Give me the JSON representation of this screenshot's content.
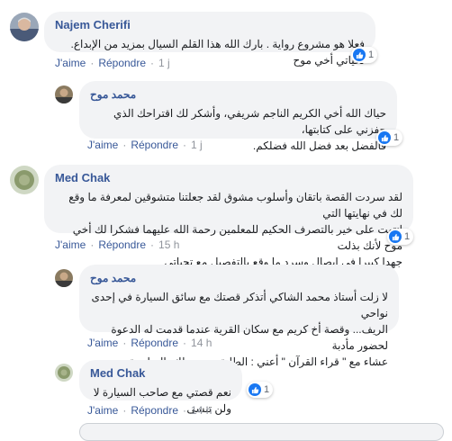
{
  "comments": [
    {
      "author": "Najem Cherifi",
      "text": "فعلا هو مشروع رواية . بارك الله هذا القلم السيال بمزيد من الإبداع. تحياتي أخي موح",
      "like_label": "J'aime",
      "reply_label": "Répondre",
      "time": "1 j",
      "reaction_count": "1"
    },
    {
      "author": "محمد موح",
      "lines": [
        "حياك الله أخي الكريم الناجم شريفي، وأشكر لك اقتراحك الذي حفزني على كتابتها،",
        "فالفضل بعد فضل الله فضلكم."
      ],
      "like_label": "J'aime",
      "reply_label": "Répondre",
      "time": "1 j",
      "reaction_count": "1"
    },
    {
      "author": "Med Chak",
      "lines": [
        "لقد سردت القصة باتقان وأسلوب مشوق لقد جعلتنا متشوقين لمعرفة ما وقع لك في نهايتها التي",
        "انتهت على خير بالتصرف الحكيم للمعلمين رحمة الله عليهما فشكرا لك أخي موح لأنك بذلت",
        "جهدا كبيرا في ايصال وسرد ما وقع بالتفصيل مع تحياتي"
      ],
      "like_label": "J'aime",
      "reply_label": "Répondre",
      "time": "15 h",
      "reaction_count": "1"
    },
    {
      "author": "محمد موح",
      "lines": [
        "لا زلت أستاذ محمد الشاكي أتذكر قصتك مع سائق السيارة في إحدى نواحي",
        "الريف... وقصة أخ كريم مع سكان القرية عندما قدمت له الدعوة لحضور مأدبة",
        "عشاء مع \" قراء القرآن \" أعني : الطلبة، تحيتي لك بالمناسبة."
      ],
      "like_label": "J'aime",
      "reply_label": "Répondre",
      "time": "14 h"
    },
    {
      "author": "Med Chak",
      "text": "نعم قصتي مع صاحب السيارة لا ولن تنسى",
      "like_label": "J'aime",
      "reply_label": "Répondre",
      "time": "14 h",
      "reaction_count": "1"
    }
  ],
  "colors": {
    "author": "#385898",
    "bubble": "#f2f3f5",
    "like_blue": "#1877f2"
  }
}
